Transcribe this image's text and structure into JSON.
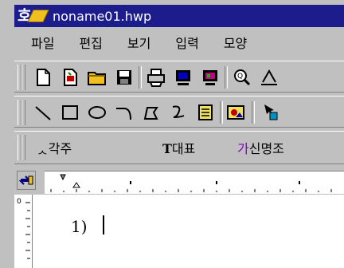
{
  "window": {
    "title": "noname01.hwp",
    "app_icon": "hwp-app-icon"
  },
  "menu": {
    "items": [
      "파일",
      "편집",
      "보기",
      "입력",
      "모양"
    ]
  },
  "toolbar1": {
    "tools": [
      "new-document",
      "open-template",
      "open-folder",
      "save-disk",
      "print",
      "print-preview",
      "screen-view",
      "zoom",
      "spell-check"
    ]
  },
  "toolbar2": {
    "tools": [
      "line",
      "rectangle",
      "ellipse",
      "arc",
      "polygon",
      "freehand",
      "text-box",
      "picture",
      "object-select"
    ]
  },
  "format_bar": {
    "style": "각주",
    "font_family": "대표",
    "font_name": "신명조"
  },
  "ruler": {
    "vertical_top": "0"
  },
  "document": {
    "line1": "1)"
  },
  "colors": {
    "titlebar": "#1c1c8c",
    "chrome": "#c0c0c0",
    "page": "#ffffff"
  }
}
